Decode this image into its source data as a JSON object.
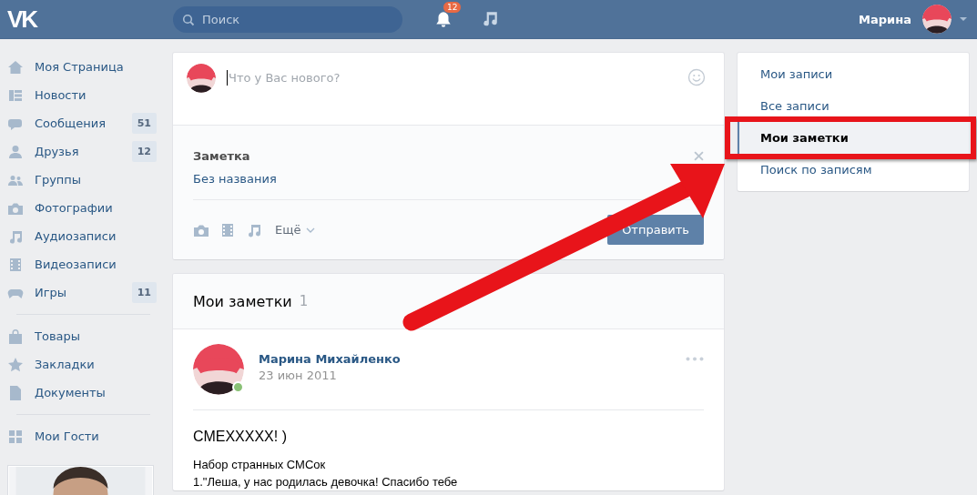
{
  "header": {
    "logo": "VK",
    "search": {
      "placeholder": "Поиск"
    },
    "notifications": "12",
    "user": "Марина"
  },
  "sidebar": {
    "groups": [
      [
        {
          "label": "Моя Страница"
        },
        {
          "label": "Новости"
        },
        {
          "label": "Сообщения",
          "counter": "51"
        },
        {
          "label": "Друзья",
          "counter": "12"
        },
        {
          "label": "Группы"
        },
        {
          "label": "Фотографии"
        },
        {
          "label": "Аудиозаписи"
        },
        {
          "label": "Видеозаписи"
        },
        {
          "label": "Игры",
          "counter": "11"
        }
      ],
      [
        {
          "label": "Товары"
        },
        {
          "label": "Закладки"
        },
        {
          "label": "Документы"
        }
      ],
      [
        {
          "label": "Мои Гости"
        }
      ]
    ],
    "photo": {
      "kind": "picture"
    }
  },
  "composer": {
    "placeholder": "Что у Вас нового?",
    "attachment": {
      "type": "Заметка",
      "title": "Без названия"
    },
    "more": "Ещё",
    "submit": "Отправить"
  },
  "notes": {
    "title": "Мои заметки",
    "count": "1",
    "post": {
      "author": "Марина Михайленко",
      "date": "23 июн 2011",
      "online": true,
      "heading": "СМЕХХХХХ! )",
      "lines": [
        "Набор странных СМСок",
        "1.\"Леша, у нас родилась девочка! Спасибо тебе"
      ]
    }
  },
  "menu": [
    {
      "label": "Мои записи",
      "selected": false
    },
    {
      "label": "Все записи",
      "selected": false
    },
    {
      "label": "Мои заметки",
      "selected": true
    },
    {
      "label": "Поиск по записям",
      "selected": false
    }
  ],
  "annotation": {
    "arrow": true,
    "highlight_selected": true
  }
}
